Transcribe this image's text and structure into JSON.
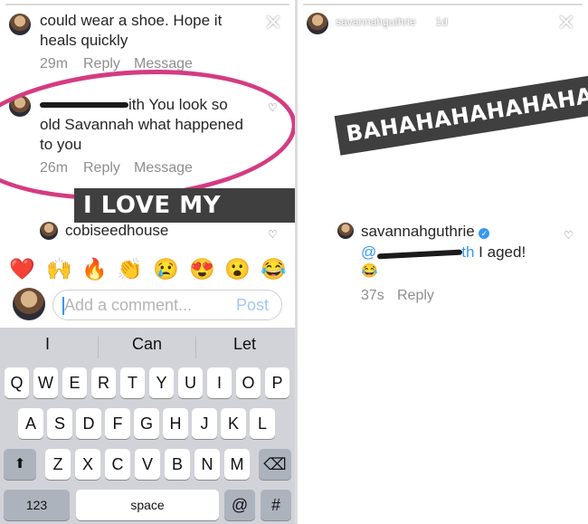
{
  "left": {
    "top_comment": {
      "line1": "could wear a shoe.  Hope it",
      "line2": "heals quickly",
      "time": "29m",
      "reply": "Reply",
      "message": "Message"
    },
    "main_comment": {
      "username_tail": "ith",
      "line1": " You look so",
      "line2": "old Savannah what happened",
      "line3": "to you",
      "time": "26m",
      "reply": "Reply",
      "message": "Message"
    },
    "sticker": "I LOVE MY FANS",
    "next_comment_user": "cobiseedhouse",
    "emojis": [
      "❤️",
      "🙌",
      "🔥",
      "👏",
      "😢",
      "😍",
      "😮",
      "😂"
    ],
    "comment_input": {
      "placeholder": "Add a comment...",
      "post": "Post"
    },
    "keyboard": {
      "suggestions": [
        "I",
        "Can",
        "Let"
      ],
      "row1": [
        "Q",
        "W",
        "E",
        "R",
        "T",
        "Y",
        "U",
        "I",
        "O",
        "P"
      ],
      "row2": [
        "A",
        "S",
        "D",
        "F",
        "G",
        "H",
        "J",
        "K",
        "L"
      ],
      "row3": [
        "Z",
        "X",
        "C",
        "V",
        "B",
        "N",
        "M"
      ],
      "shift": "⬆",
      "delete": "⌫",
      "numbers": "123",
      "space": "space",
      "at": "@",
      "hash": "#"
    }
  },
  "right": {
    "header": {
      "username": "savannahguthrie",
      "age": "1d"
    },
    "sticker": "BAHAHAHAHAHAHA",
    "reply": {
      "username": "savannahguthrie",
      "mention_start": "@",
      "mention_tail": "th",
      "text": " I aged!",
      "emoji": "😂",
      "time": "37s",
      "reply_label": "Reply"
    }
  },
  "colors": {
    "circle": "#d53b82",
    "link": "#3897f0",
    "verified": "#3897f0",
    "sticker_bg": "#3f3f3f"
  }
}
